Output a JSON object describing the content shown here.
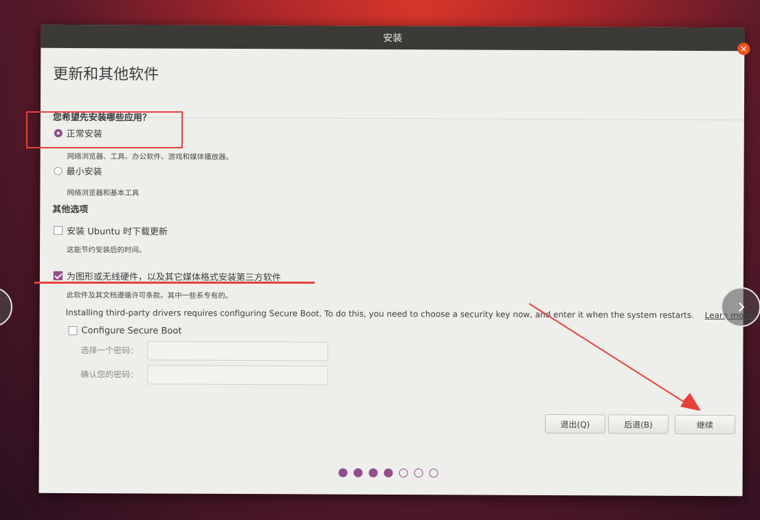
{
  "window": {
    "title": "安装",
    "close_glyph": "×"
  },
  "page_title": "更新和其他软件",
  "install_question": "您希望先安装哪些应用？",
  "options": {
    "normal": {
      "label": "正常安装",
      "desc": "网络浏览器、工具、办公软件、游戏和媒体播放器。",
      "selected": true
    },
    "minimal": {
      "label": "最小安装",
      "desc": "网络浏览器和基本工具",
      "selected": false
    }
  },
  "other_options_heading": "其他选项",
  "updates": {
    "label": "安装 Ubuntu 时下载更新",
    "desc": "这能节约安装后的时间。",
    "checked": false
  },
  "third_party": {
    "label": "为图形或无线硬件，以及其它媒体格式安装第三方软件",
    "desc": "此软件及其文档遵循许可条款。其中一些系专有的。",
    "checked": true
  },
  "secure_boot": {
    "info": "Installing third-party drivers requires configuring Secure Boot. To do this, you need to choose a security key now, and enter it when the system restarts.",
    "learn_more": "Learn more...",
    "configure_label": "Configure Secure Boot",
    "configure_checked": false,
    "password_label": "选择一个密码：",
    "confirm_label": "确认您的密码："
  },
  "buttons": {
    "quit": "退出(Q)",
    "back": "后退(B)",
    "continue": "继续"
  },
  "progress": {
    "current_step": 4,
    "total_steps": 7
  },
  "colors": {
    "accent": "#924d8b",
    "titlebar": "#3b3a36",
    "annotation": "#e8413a",
    "close": "#e95420"
  },
  "icons": {
    "next": "chevron-right-icon",
    "prev": "chevron-left-icon",
    "close": "close-icon"
  }
}
